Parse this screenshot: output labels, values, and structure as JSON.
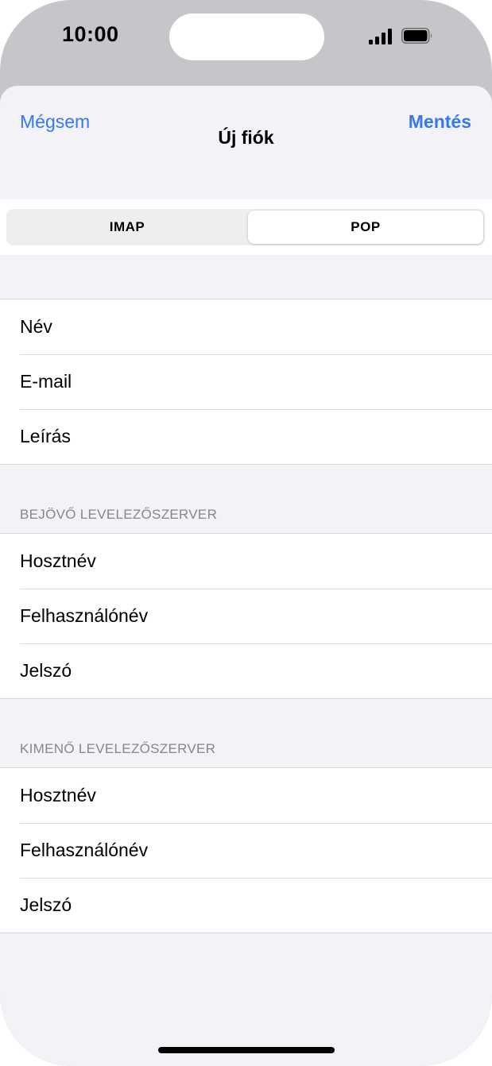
{
  "status_bar": {
    "time": "10:00",
    "signal_icon": "cellular-signal-icon",
    "battery_icon": "battery-full-icon"
  },
  "nav": {
    "cancel_label": "Mégsem",
    "title": "Új fiók",
    "save_label": "Mentés"
  },
  "segmented_control": {
    "options": [
      "IMAP",
      "POP"
    ],
    "selected": "POP"
  },
  "account_section": {
    "rows": [
      "Név",
      "E-mail",
      "Leírás"
    ]
  },
  "incoming_section": {
    "header": "BEJÖVŐ LEVELEZŐSZERVER",
    "rows": [
      "Hosztnév",
      "Felhasználónév",
      "Jelszó"
    ]
  },
  "outgoing_section": {
    "header": "KIMENŐ LEVELEZŐSZERVER",
    "rows": [
      "Hosztnév",
      "Felhasználónév",
      "Jelszó"
    ]
  },
  "colors": {
    "accent": "#3478f6",
    "grouped_background": "#f2f2f7",
    "section_header": "#86868b"
  }
}
